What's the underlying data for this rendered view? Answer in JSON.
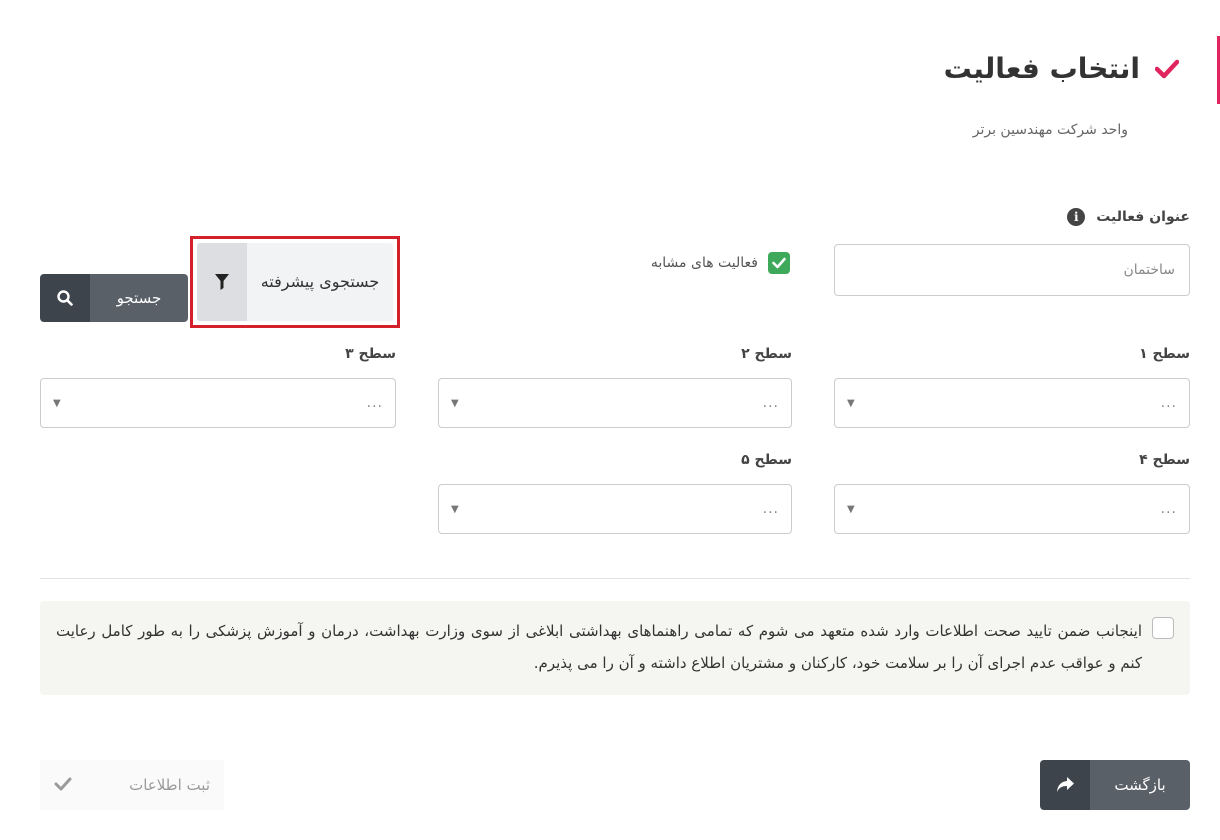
{
  "header": {
    "title": "انتخاب فعالیت",
    "subtitle": "واحد شرکت مهندسین برتر"
  },
  "activity": {
    "label": "عنوان فعالیت",
    "info_icon": "i",
    "placeholder": "ساختمان"
  },
  "similar": {
    "label": "فعالیت های مشابه",
    "checked": true
  },
  "advanced_search": {
    "label": "جستجوی پیشرفته",
    "icon": "filter-icon"
  },
  "search": {
    "label": "جستجو",
    "icon": "search-icon"
  },
  "levels": [
    {
      "label": "سطح ۱",
      "value": "..."
    },
    {
      "label": "سطح ۲",
      "value": "..."
    },
    {
      "label": "سطح ۳",
      "value": "..."
    },
    {
      "label": "سطح ۴",
      "value": "..."
    },
    {
      "label": "سطح ۵",
      "value": "..."
    }
  ],
  "agreement": {
    "text": "اینجانب ضمن تایید صحت اطلاعات وارد شده متعهد می شوم که تمامی راهنماهای بهداشتی ابلاغی از سوی وزارت بهداشت، درمان و آموزش پزشکی را به طور کامل رعایت کنم و عواقب عدم اجرای آن را بر سلامت خود، کارکنان و مشتریان اطلاع داشته و آن را می پذیرم."
  },
  "footer": {
    "back_label": "بازگشت",
    "submit_label": "ثبت اطلاعات"
  },
  "colors": {
    "accent": "#e0245e",
    "highlight_border": "#d4202b",
    "checkbox_green": "#3ea95a",
    "button_dark": "#3e444b",
    "button": "#5a6068"
  }
}
